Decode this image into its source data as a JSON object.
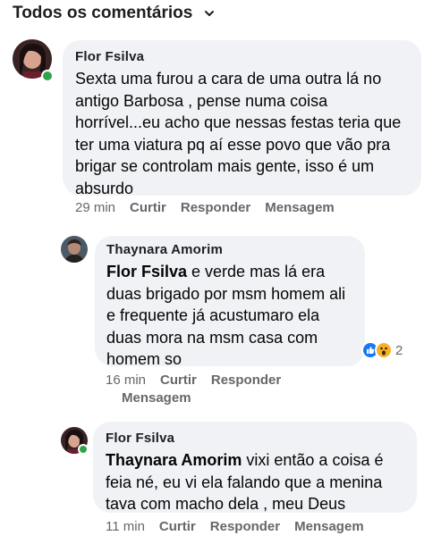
{
  "header": {
    "label": "Todos os comentários"
  },
  "comments": [
    {
      "author": "Flor Fsilva",
      "text": "Sexta uma furou a cara de uma outra lá no antigo Barbosa , pense numa coisa horrível...eu acho que nessas festas teria que ter uma viatura pq aí esse povo que vão pra brigar se controlam mais gente, isso é um absurdo",
      "time": "29 min",
      "like": "Curtir",
      "reply": "Responder",
      "message": "Mensagem"
    },
    {
      "author": "Thaynara Amorim",
      "mention": "Flor Fsilva",
      "text": " e verde mas lá era duas brigado por msm homem ali e frequente já acustumaro ela duas mora na msm casa com homem so",
      "time": "16 min",
      "like": "Curtir",
      "reply": "Responder",
      "message": "Mensagem",
      "reaction_count": "2"
    },
    {
      "author": "Flor Fsilva",
      "mention": "Thaynara Amorim",
      "text": " vixi então a coisa é feia né, eu vi ela falando que a menina tava com macho dela , meu Deus",
      "time": "11 min",
      "like": "Curtir",
      "reply": "Responder",
      "message": "Mensagem"
    }
  ],
  "colors": {
    "bubble": "#f0f2f5",
    "online": "#31a24c",
    "like": "#1877f2",
    "wow": "#f7b125"
  },
  "icons": {
    "sort": "chevron-down-icon",
    "reaction1": "like-reaction-icon",
    "reaction2": "wow-reaction-icon"
  }
}
